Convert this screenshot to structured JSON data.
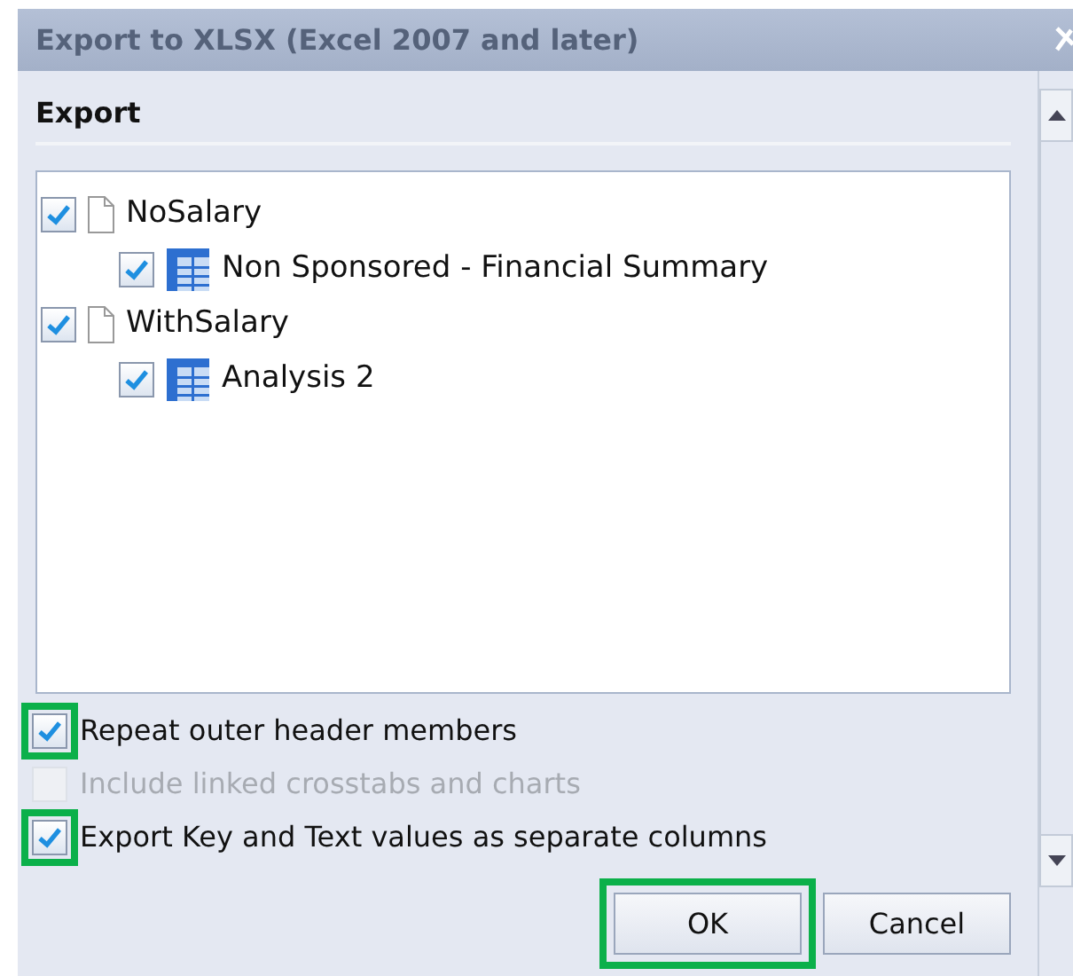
{
  "window": {
    "title": "Export to XLSX (Excel 2007 and later)"
  },
  "section": {
    "title": "Export"
  },
  "tree": [
    {
      "label": "NoSalary",
      "kind": "document",
      "checked": true,
      "children": [
        {
          "label": "Non Sponsored - Financial Summary",
          "kind": "table",
          "checked": true
        }
      ]
    },
    {
      "label": "WithSalary",
      "kind": "document",
      "checked": true,
      "children": [
        {
          "label": "Analysis 2",
          "kind": "table",
          "checked": true
        }
      ]
    }
  ],
  "options": [
    {
      "label": "Repeat outer header members",
      "checked": true,
      "disabled": false,
      "highlighted": true
    },
    {
      "label": "Include linked crosstabs and charts",
      "checked": false,
      "disabled": true,
      "highlighted": false
    },
    {
      "label": "Export Key and Text values as separate columns",
      "checked": true,
      "disabled": false,
      "highlighted": true
    }
  ],
  "buttons": [
    {
      "label": "OK",
      "highlighted": true
    },
    {
      "label": "Cancel",
      "highlighted": false
    }
  ]
}
